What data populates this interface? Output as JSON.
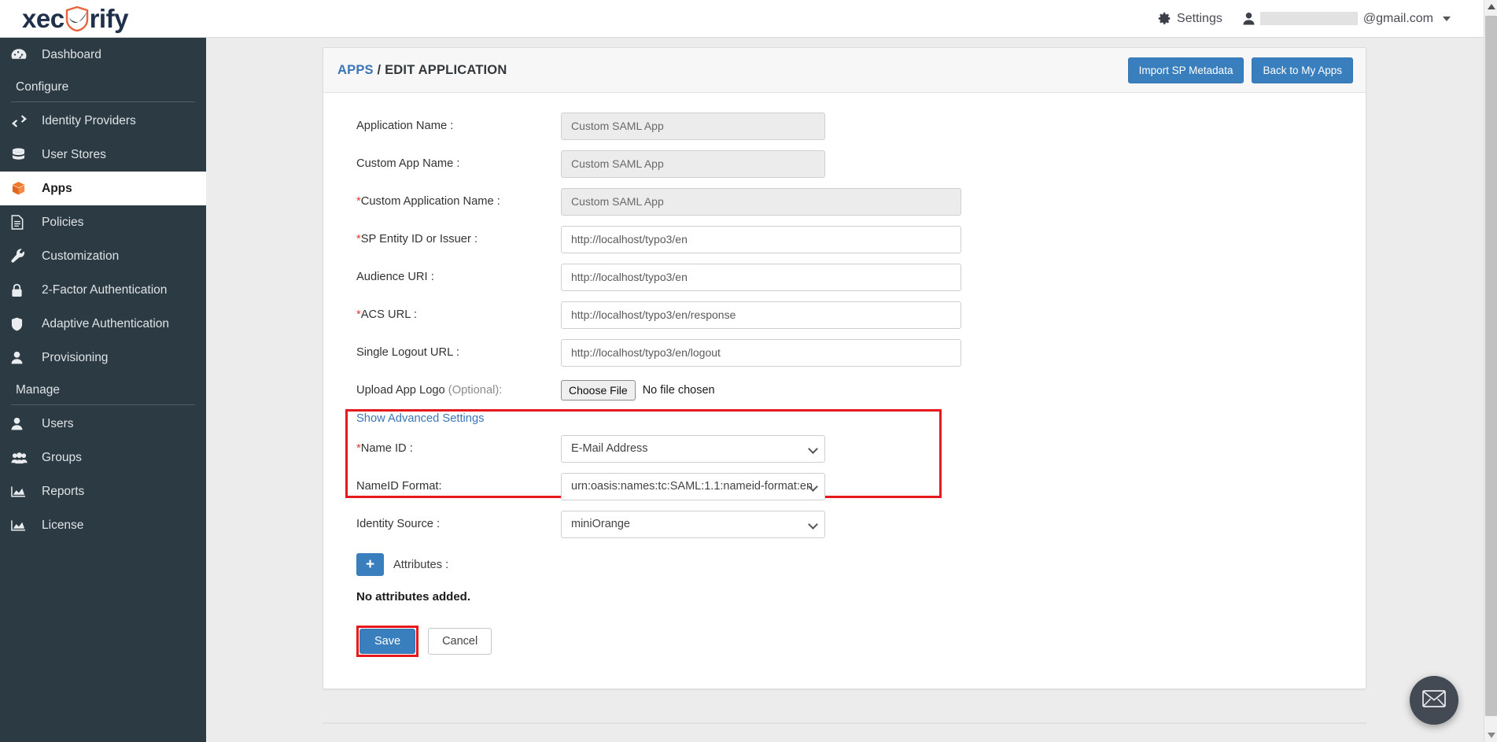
{
  "brand": {
    "text_before": "xec",
    "text_after": "rify",
    "shield_icon": "shield-check-icon"
  },
  "topbar": {
    "settings_label": "Settings",
    "account_email_suffix": "@gmail.com",
    "gear_icon": "gear-icon",
    "user_icon": "user-icon",
    "caret_icon": "chevron-down-icon"
  },
  "sidebar": {
    "items": [
      {
        "label": "Dashboard",
        "icon": "dashboard-icon",
        "type": "item",
        "active": false
      },
      {
        "label": "Configure",
        "type": "section"
      },
      {
        "label": "Identity Providers",
        "icon": "exchange-arrows-icon",
        "type": "item",
        "active": false
      },
      {
        "label": "User Stores",
        "icon": "database-icon",
        "type": "item",
        "active": false
      },
      {
        "label": "Apps",
        "icon": "box-icon",
        "type": "item",
        "active": true
      },
      {
        "label": "Policies",
        "icon": "document-icon",
        "type": "item",
        "active": false
      },
      {
        "label": "Customization",
        "icon": "wrench-icon",
        "type": "item",
        "active": false
      },
      {
        "label": "2-Factor Authentication",
        "icon": "lock-icon",
        "type": "item",
        "active": false
      },
      {
        "label": "Adaptive Authentication",
        "icon": "shield-icon",
        "type": "item",
        "active": false
      },
      {
        "label": "Provisioning",
        "icon": "user-icon",
        "type": "item",
        "active": false
      },
      {
        "label": "Manage",
        "type": "section"
      },
      {
        "label": "Users",
        "icon": "user-icon",
        "type": "item",
        "active": false
      },
      {
        "label": "Groups",
        "icon": "users-group-icon",
        "type": "item",
        "active": false
      },
      {
        "label": "Reports",
        "icon": "chart-area-icon",
        "type": "item",
        "active": false
      },
      {
        "label": "License",
        "icon": "chart-area-icon",
        "type": "item",
        "active": false
      }
    ]
  },
  "page": {
    "breadcrumb_root": "APPS",
    "breadcrumb_rest": " / EDIT APPLICATION",
    "import_button": "Import SP Metadata",
    "back_button": "Back to My Apps"
  },
  "form": {
    "fields": [
      {
        "label": "Application Name :",
        "required": false,
        "value": "Custom SAML App",
        "disabled": true,
        "width": "short"
      },
      {
        "label": "Custom App Name :",
        "required": false,
        "value": "Custom SAML App",
        "disabled": true,
        "width": "short"
      },
      {
        "label": "Custom Application Name :",
        "required": true,
        "value": "Custom SAML App",
        "disabled": true,
        "width": "long"
      },
      {
        "label": "SP Entity ID or Issuer :",
        "required": true,
        "value": "http://localhost/typo3/en",
        "disabled": false,
        "width": "long"
      },
      {
        "label": "Audience URI :",
        "required": false,
        "value": "http://localhost/typo3/en",
        "disabled": false,
        "width": "long"
      },
      {
        "label": "ACS URL :",
        "required": true,
        "value": "http://localhost/typo3/en/response",
        "disabled": false,
        "width": "long"
      },
      {
        "label": "Single Logout URL :",
        "required": false,
        "value": "http://localhost/typo3/en/logout",
        "disabled": false,
        "width": "long"
      }
    ],
    "upload": {
      "label_main": "Upload App Logo ",
      "label_optional": "(Optional):",
      "choose_file_button": "Choose File",
      "file_status": "No file chosen"
    },
    "advanced_link": "Show Advanced Settings",
    "selects": [
      {
        "label": "Name ID :",
        "required": true,
        "value": "E-Mail Address"
      },
      {
        "label": "NameID Format:",
        "required": false,
        "value": "urn:oasis:names:tc:SAML:1.1:nameid-format:en"
      },
      {
        "label": "Identity Source :",
        "required": false,
        "value": "miniOrange"
      }
    ],
    "attributes": {
      "add_icon": "plus-icon",
      "label": "Attributes :",
      "empty_text": "No attributes added."
    },
    "save_button": "Save",
    "cancel_button": "Cancel"
  },
  "chat": {
    "icon": "envelope-icon"
  },
  "colors": {
    "accent_blue": "#3a7fbd",
    "link_blue": "#3a76b5",
    "sidebar_bg": "#2b3a43",
    "highlight_red": "#e8191c",
    "brand_orange": "#e8643c",
    "brand_navy": "#21304a"
  }
}
